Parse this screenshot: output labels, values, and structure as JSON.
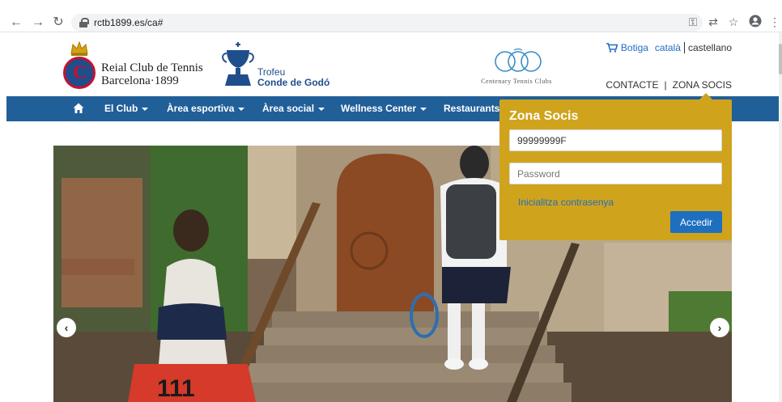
{
  "browser": {
    "url": "rctb1899.es/ca#",
    "back_icon": "back-arrow-icon",
    "forward_icon": "forward-arrow-icon",
    "reload_icon": "reload-icon",
    "toolbar_icons": [
      "key-icon",
      "translate-icon",
      "star-icon",
      "account-icon",
      "menu-dots-icon"
    ]
  },
  "header": {
    "logo_line1": "Reial Club de Tennis",
    "logo_line2": "Barcelona·1899",
    "trofeu_line1": "Trofeu",
    "trofeu_line2": "Conde de Godó",
    "centenary_text": "Centenary Tennis Clubs",
    "shop_label": "Botiga",
    "lang_ca": "català",
    "lang_es": "castellano",
    "contact_label": "CONTACTE",
    "zona_socis_label": "ZONA SOCIS",
    "brand_blue": "#215f98",
    "brand_red": "#c8102e"
  },
  "nav": {
    "items": [
      {
        "label": "El Club",
        "dropdown": true
      },
      {
        "label": "Àrea esportiva",
        "dropdown": true
      },
      {
        "label": "Àrea social",
        "dropdown": true
      },
      {
        "label": "Wellness Center",
        "dropdown": true
      },
      {
        "label": "Restaurants",
        "dropdown": false
      }
    ]
  },
  "login": {
    "title": "Zona Socis",
    "user_value": "99999999F",
    "password_placeholder": "Password",
    "reset_link": "Inicialitza contrasenya",
    "submit_label": "Accedir",
    "panel_color": "#d0a31d",
    "button_color": "#1e6fc0"
  },
  "hero": {
    "prev_label": "‹",
    "next_label": "›",
    "bag_text": "111"
  }
}
